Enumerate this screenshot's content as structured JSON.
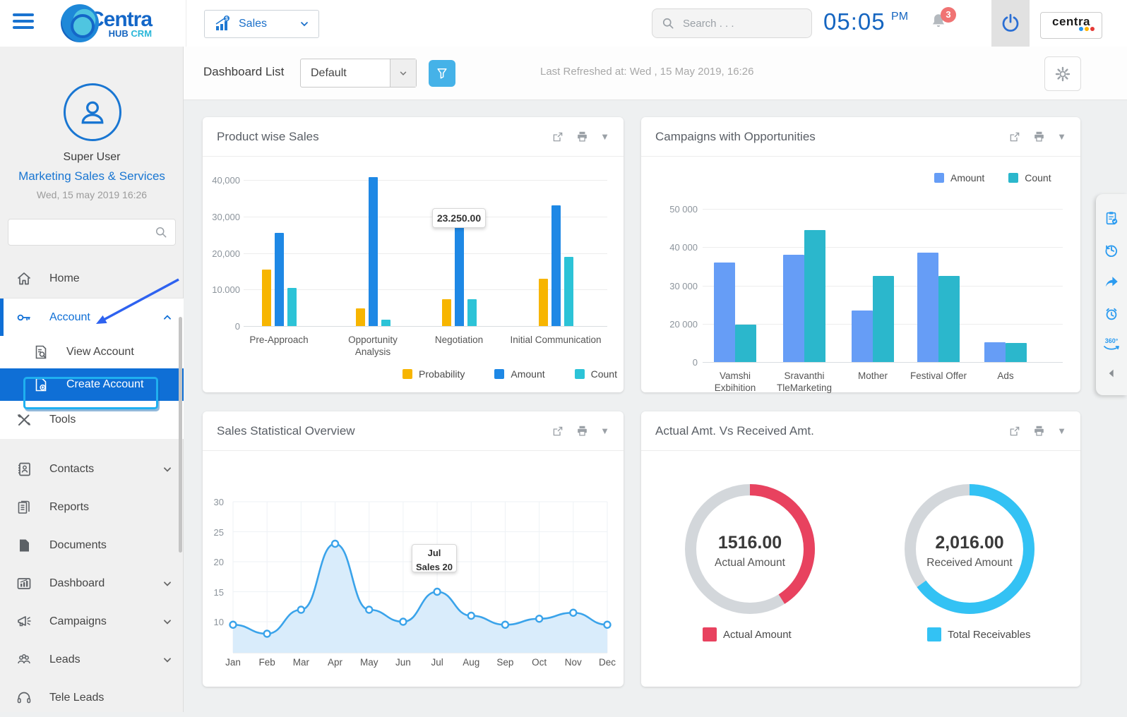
{
  "colors": {
    "brand_blue": "#1565c0",
    "active_blue": "#0f6fd6",
    "annotation_cyan": "#1fb0f0",
    "annotation_arrow": "#2e62f0",
    "filter_btn": "#45b2e8",
    "badge_red": "#f07373"
  },
  "topbar": {
    "brand": {
      "name": "Centra",
      "sub1": "HUB",
      "sub2": "CRM"
    },
    "module_selector": {
      "value": "Sales"
    },
    "search": {
      "placeholder": "Search . . ."
    },
    "clock": {
      "time": "05:05",
      "meridiem": "PM"
    },
    "notifications": {
      "badge": "3"
    },
    "corner_logo": {
      "text": "centra"
    }
  },
  "sidebar": {
    "user": {
      "name": "Super User",
      "org": "Marketing Sales & Services",
      "datetime": "Wed, 15 may 2019 16:26"
    },
    "search": {
      "placeholder": ""
    },
    "items": [
      {
        "label": "Home"
      },
      {
        "label": "Account"
      },
      {
        "label": "View Account"
      },
      {
        "label": "Create Account"
      },
      {
        "label": "Tools"
      },
      {
        "label": "Contacts"
      },
      {
        "label": "Reports"
      },
      {
        "label": "Documents"
      },
      {
        "label": "Dashboard"
      },
      {
        "label": "Campaigns"
      },
      {
        "label": "Leads"
      },
      {
        "label": "Tele Leads"
      }
    ]
  },
  "dashboard_header": {
    "title": "Dashboard List",
    "view_selector": "Default",
    "last_refreshed": "Last Refreshed at: Wed , 15 May 2019, 16:26"
  },
  "right_toolbar": {
    "icons": [
      "tasks-icon",
      "history-icon",
      "share-icon",
      "reminder-icon",
      "360-view-icon",
      "collapse-icon"
    ]
  },
  "chart_data": [
    {
      "type": "bar",
      "title": "Product wise Sales",
      "categories": [
        "Pre-Approach",
        "Opportunity\nAnalysis",
        "Negotiation",
        "Initial Communication"
      ],
      "series": [
        {
          "name": "Probability",
          "color": "#f7b500",
          "values": [
            15500,
            4800,
            7300,
            13000
          ]
        },
        {
          "name": "Amount",
          "color": "#1e88e5",
          "values": [
            25500,
            40800,
            28500,
            33000
          ]
        },
        {
          "name": "Count",
          "color": "#2cc3d7",
          "values": [
            10500,
            1800,
            7300,
            19000
          ]
        }
      ],
      "ylabel_ticks": [
        "0",
        "10.000",
        "20,000",
        "30,000",
        "40,000"
      ],
      "tick_values": [
        0,
        10000,
        20000,
        30000,
        40000
      ],
      "ylim": [
        0,
        41500
      ],
      "grid": true,
      "legend_position": "bottom",
      "tooltip": {
        "text": "23.250.00",
        "category": "Negotiation",
        "series": "Amount"
      }
    },
    {
      "type": "bar",
      "title": "Campaigns with Opportunities",
      "categories": [
        "Vamshi\nExbihition",
        "Sravanthi\nTleMarketing",
        "Mother",
        "Festival Offer",
        "Ads"
      ],
      "series": [
        {
          "name": "Amount",
          "color": "#669df6",
          "values": [
            36000,
            38000,
            23500,
            38500,
            10500
          ]
        },
        {
          "name": "Count",
          "color": "#2bb7cc",
          "values": [
            19500,
            44500,
            32500,
            32500,
            10000
          ]
        }
      ],
      "ylabel_ticks": [
        "0",
        "20 000",
        "30 000",
        "40 000",
        "50 000"
      ],
      "tick_values": [
        0,
        20000,
        30000,
        40000,
        50000
      ],
      "ylim": [
        0,
        50000
      ],
      "grid": true,
      "legend_position": "top-right"
    },
    {
      "type": "area",
      "title": "Sales Statistical Overview",
      "x": [
        "Jan",
        "Feb",
        "Mar",
        "Apr",
        "May",
        "Jun",
        "Jul",
        "Aug",
        "Sep",
        "Oct",
        "Nov",
        "Dec"
      ],
      "series": [
        {
          "name": "Sales",
          "color": "#3aa3ea",
          "fill": "#d9ecfb",
          "values": [
            9.5,
            8,
            12,
            23,
            12,
            10,
            15,
            11,
            9.5,
            10.5,
            11.5,
            9.5
          ]
        }
      ],
      "ylabel_ticks": [
        "10",
        "15",
        "20",
        "25",
        "30"
      ],
      "tick_values": [
        10,
        15,
        20,
        25,
        30
      ],
      "ylim": [
        5,
        30
      ],
      "grid": true,
      "tooltip": {
        "line1": "Jul",
        "line2": "Sales 20",
        "category": "Jul"
      }
    },
    {
      "type": "pie",
      "title": "Actual Amt. Vs Received Amt.",
      "donuts": [
        {
          "value": "1516.00",
          "label": "Actual Amount",
          "percent": 41,
          "color": "#e8425f",
          "track": "#d3d7db",
          "legend": "Actual Amount"
        },
        {
          "value": "2,016.00",
          "label": "Received Amount",
          "percent": 65,
          "color": "#33c2f4",
          "track": "#d3d7db",
          "legend": "Total Receivables"
        }
      ]
    }
  ]
}
